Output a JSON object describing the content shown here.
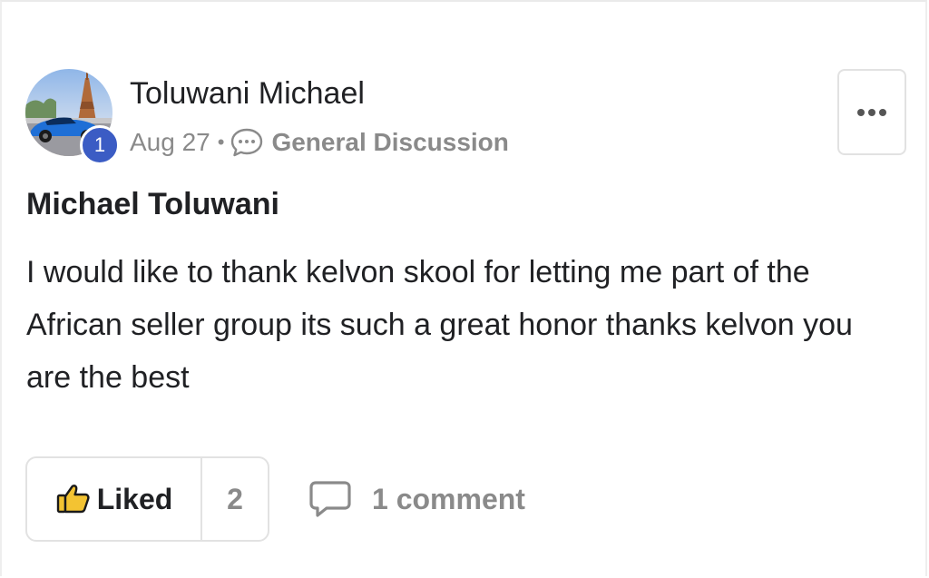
{
  "post": {
    "author": {
      "name": "Toluwani Michael",
      "level": "1"
    },
    "meta": {
      "date": "Aug 27",
      "separator": "•",
      "category": "General Discussion"
    },
    "more_label": "•••",
    "title": "Michael Toluwani",
    "body": "I would like to thank kelvon skool for letting me part of the African seller group its such a great honor thanks kelvon you are the best",
    "actions": {
      "like_label": "Liked",
      "like_count": "2",
      "comment_label": "1 comment"
    }
  },
  "icons": {
    "avatar": "avatar-photo-car-eiffel-tower",
    "category": "chat-bubble-icon",
    "more": "more-horizontal-icon",
    "like": "thumbs-up-icon",
    "comment": "comment-bubble-icon"
  },
  "colors": {
    "level_badge": "#3b5cc4",
    "like_accent": "#f3c332",
    "muted_text": "#8a8a8a",
    "primary_text": "#202124",
    "border": "#e2e2e2"
  }
}
